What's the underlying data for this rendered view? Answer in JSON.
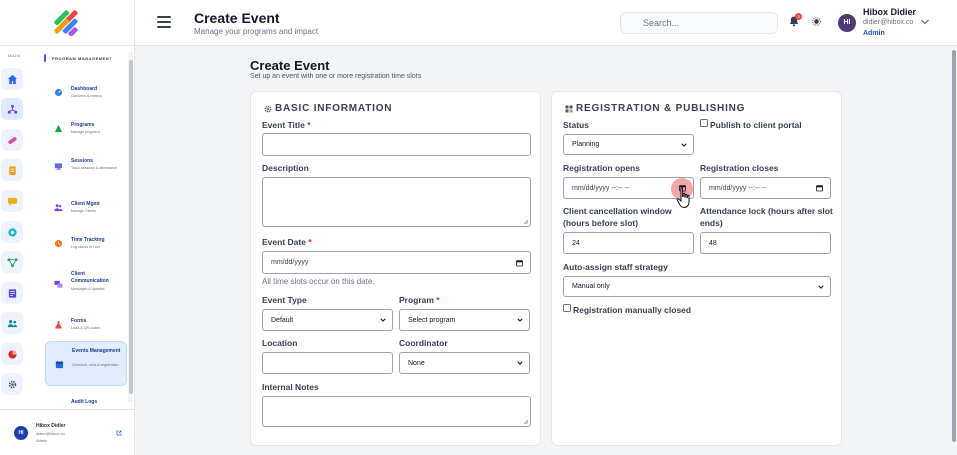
{
  "header": {
    "title": "Create Event",
    "subtitle": "Manage your programs and impact",
    "search_placeholder": "Search...",
    "notification_count": "3",
    "user": {
      "initials": "HI",
      "name": "Hibox Didier",
      "email": "didier@hibox.co",
      "role": "Admin"
    }
  },
  "sidebar": {
    "rail_label": "MAIN",
    "section_title": "PROGRAM MANAGEMENT",
    "items": [
      {
        "label": "Dashboard",
        "desc": "Overview & metrics"
      },
      {
        "label": "Programs",
        "desc": "Manage programs"
      },
      {
        "label": "Sessions",
        "desc": "Track sessions & attendance"
      },
      {
        "label": "Client Mgmt",
        "desc": "Manage Clients"
      },
      {
        "label": "Time Tracking",
        "desc": "Log clients in / out"
      },
      {
        "label": "Client Communication",
        "desc": "Messages & updates"
      },
      {
        "label": "Forms",
        "desc": "Links & QR codes"
      },
      {
        "label": "Events Management",
        "desc": "Schedule, slots & registration"
      },
      {
        "label": "Audit Logs",
        "desc": ""
      }
    ],
    "footer": {
      "initials": "HI",
      "name": "Hibox Didier",
      "email": "didier@hibox.co",
      "role": "Admin"
    }
  },
  "page": {
    "title": "Create Event",
    "subtitle": "Set up an event with one or more registration time slots"
  },
  "basic": {
    "title": "BASIC INFORMATION",
    "event_title_label": "Event Title",
    "description_label": "Description",
    "event_date_label": "Event Date",
    "event_date_value": "mm/dd/yyyy",
    "event_date_help": "All time slots occur on this date.",
    "event_type_label": "Event Type",
    "event_type_value": "Default",
    "program_label": "Program",
    "program_value": "Select program",
    "location_label": "Location",
    "coordinator_label": "Coordinator",
    "coordinator_value": "None",
    "notes_label": "Internal Notes",
    "required_mark": "*"
  },
  "registration": {
    "title": "REGISTRATION & PUBLISHING",
    "status_label": "Status",
    "status_value": "Planning",
    "publish_label": "Publish to client portal",
    "opens_label": "Registration opens",
    "opens_value": "mm/dd/yyyy --:-- --",
    "closes_label": "Registration closes",
    "closes_value": "mm/dd/yyyy --:-- --",
    "cancel_label": "Client cancellation window (hours before slot)",
    "cancel_value": "24",
    "lock_label": "Attendance lock (hours after slot ends)",
    "lock_value": "48",
    "auto_assign_label": "Auto-assign staff strategy",
    "auto_assign_value": "Manual only",
    "manual_closed_label": "Registration manually closed"
  },
  "colors": {
    "accent": "#1d4ed8",
    "required": "#dc2626",
    "active_nav": "#e0ecff"
  }
}
